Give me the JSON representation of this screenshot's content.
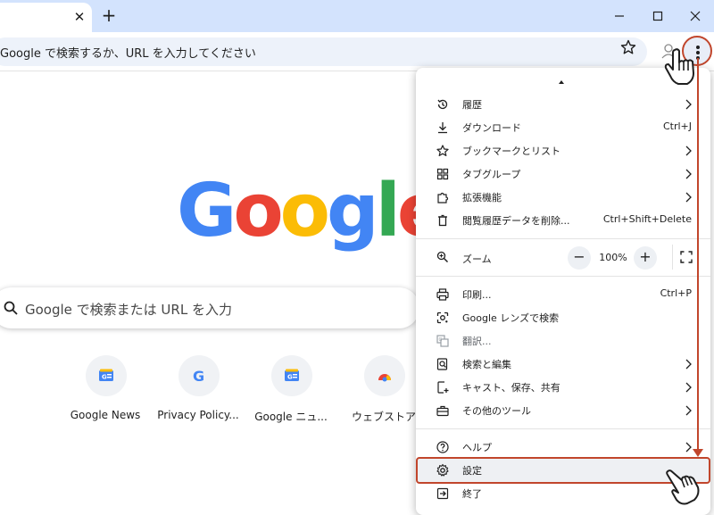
{
  "tabs": {
    "close_glyph": "✕",
    "new_tab_glyph": "+"
  },
  "window_controls": [
    "minimize-icon",
    "maximize-icon",
    "close-icon"
  ],
  "omnibox": {
    "text": "Google で検索するか、URL を入力してください"
  },
  "google_logo": {
    "letters": [
      "G",
      "o",
      "o",
      "g",
      "l",
      "e"
    ],
    "colors": [
      "#4285f4",
      "#ea4335",
      "#fbbc05",
      "#4285f4",
      "#34a853",
      "#ea4335"
    ]
  },
  "search": {
    "placeholder": "Google で検索または URL を入力"
  },
  "shortcuts": [
    {
      "label": "Google News",
      "icon": "google-news-icon"
    },
    {
      "label": "Privacy Policy...",
      "icon": "google-g-icon"
    },
    {
      "label": "Google ニュ...",
      "icon": "google-news-icon"
    },
    {
      "label": "ウェブストア",
      "icon": "chrome-web-store-icon"
    }
  ],
  "menu": {
    "items_group1": [
      {
        "label": "履歴",
        "shortcut": "",
        "submenu": true,
        "icon": "history-icon"
      },
      {
        "label": "ダウンロード",
        "shortcut": "Ctrl+J",
        "submenu": false,
        "icon": "download-icon"
      },
      {
        "label": "ブックマークとリスト",
        "shortcut": "",
        "submenu": true,
        "icon": "star-icon"
      },
      {
        "label": "タブグループ",
        "shortcut": "",
        "submenu": true,
        "icon": "tab-groups-icon"
      },
      {
        "label": "拡張機能",
        "shortcut": "",
        "submenu": true,
        "icon": "extension-icon"
      },
      {
        "label": "閲覧履歴データを削除...",
        "shortcut": "Ctrl+Shift+Delete",
        "submenu": false,
        "icon": "trash-icon"
      }
    ],
    "zoom": {
      "label": "ズーム",
      "minus": "−",
      "value": "100%",
      "plus": "+"
    },
    "items_group2": [
      {
        "label": "印刷...",
        "shortcut": "Ctrl+P",
        "submenu": false,
        "icon": "print-icon"
      },
      {
        "label": "Google レンズで検索",
        "shortcut": "",
        "submenu": false,
        "icon": "lens-icon"
      },
      {
        "label": "翻訳...",
        "shortcut": "",
        "submenu": false,
        "icon": "translate-icon",
        "disabled": true
      },
      {
        "label": "検索と編集",
        "shortcut": "",
        "submenu": true,
        "icon": "find-icon"
      },
      {
        "label": "キャスト、保存、共有",
        "shortcut": "",
        "submenu": true,
        "icon": "cast-icon"
      },
      {
        "label": "その他のツール",
        "shortcut": "",
        "submenu": true,
        "icon": "toolbox-icon"
      }
    ],
    "items_group3": [
      {
        "label": "ヘルプ",
        "shortcut": "",
        "submenu": true,
        "icon": "help-icon"
      },
      {
        "label": "設定",
        "shortcut": "",
        "submenu": false,
        "icon": "settings-gear-icon"
      },
      {
        "label": "終了",
        "shortcut": "",
        "submenu": false,
        "icon": "exit-icon"
      }
    ]
  },
  "colors": {
    "accent_annotation": "#c1462c",
    "tabstrip": "#d3e3fd",
    "omnibox": "#edf2fa"
  }
}
